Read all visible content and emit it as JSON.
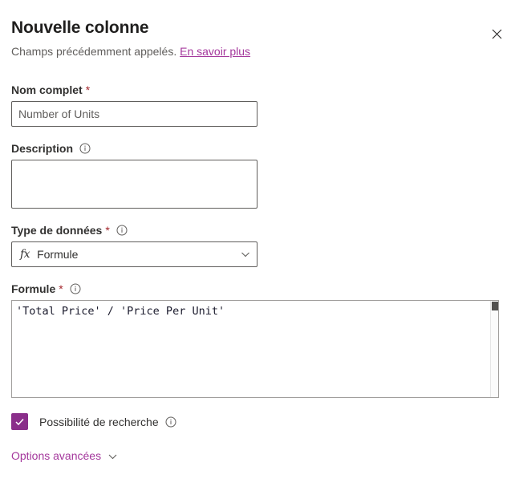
{
  "panel": {
    "title": "Nouvelle colonne",
    "subtitle_text": "Champs précédemment appelés.",
    "learn_more_label": "En savoir plus",
    "close_icon": "close-icon"
  },
  "fields": {
    "display_name": {
      "label": "Nom complet",
      "required_marker": "*",
      "value": "Number of Units",
      "placeholder": "Number of Units"
    },
    "description": {
      "label": "Description",
      "info_icon": "info-icon",
      "value": "",
      "placeholder": ""
    },
    "data_type": {
      "label": "Type de données",
      "required_marker": "*",
      "info_icon": "info-icon",
      "prefix_icon": "fx-icon",
      "prefix_icon_text": "fx",
      "selected_value": "Formule",
      "chevron_icon": "chevron-down-icon"
    },
    "formula": {
      "label": "Formule",
      "required_marker": "*",
      "info_icon": "info-icon",
      "value": "'Total Price' / 'Price Per Unit'"
    },
    "searchable": {
      "label": "Possibilité de recherche",
      "checked": true,
      "check_icon": "checkmark-icon",
      "info_icon": "info-icon"
    }
  },
  "advanced": {
    "label": "Options avancées",
    "chevron_icon": "chevron-down-icon"
  },
  "colors": {
    "accent_purple": "#8a2e8a",
    "link_purple": "#a4379c",
    "required_red": "#a4262c",
    "label_text": "#323130",
    "muted_text": "#605e5c",
    "border": "#605e5c",
    "formula_border": "#a19f9d"
  }
}
